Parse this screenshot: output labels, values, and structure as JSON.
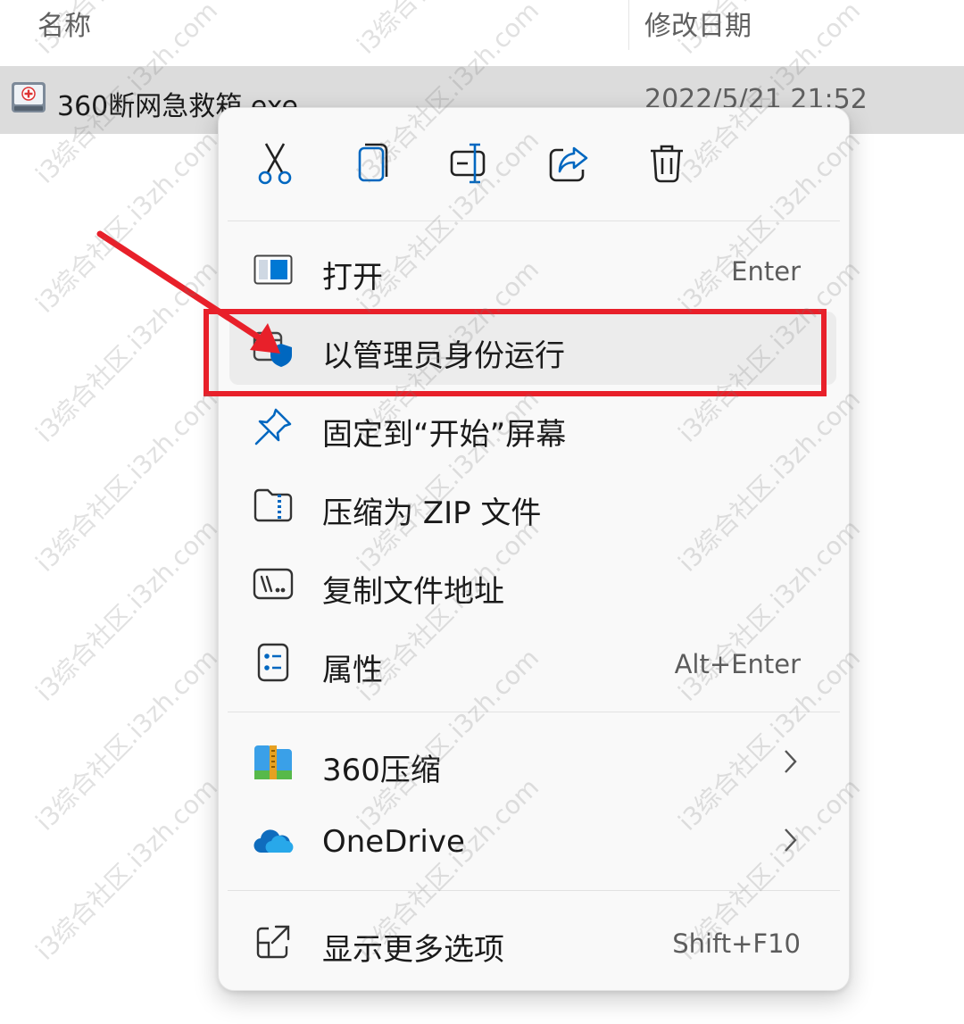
{
  "explorer": {
    "col_name": "名称",
    "col_date": "修改日期",
    "file": {
      "name": "360断网急救箱.exe",
      "date": "2022/5/21 21:52",
      "icon": "app-exe-icon"
    }
  },
  "menu": {
    "toolbar": [
      {
        "name": "cut",
        "icon": "scissors-icon"
      },
      {
        "name": "copy",
        "icon": "copy-icon"
      },
      {
        "name": "rename",
        "icon": "rename-icon"
      },
      {
        "name": "share",
        "icon": "share-icon"
      },
      {
        "name": "delete",
        "icon": "trash-icon"
      }
    ],
    "items": [
      {
        "label": "打开",
        "shortcut": "Enter",
        "icon": "open-window-icon"
      },
      {
        "label": "以管理员身份运行",
        "shortcut": "",
        "icon": "admin-shield-icon",
        "highlighted": true
      },
      {
        "label": "固定到“开始”屏幕",
        "shortcut": "",
        "icon": "pin-icon"
      },
      {
        "label": "压缩为 ZIP 文件",
        "shortcut": "",
        "icon": "zip-folder-icon"
      },
      {
        "label": "复制文件地址",
        "shortcut": "",
        "icon": "copy-path-icon"
      },
      {
        "label": "属性",
        "shortcut": "Alt+Enter",
        "icon": "properties-icon"
      }
    ],
    "submenus": [
      {
        "label": "360压缩",
        "icon": "360-zip-icon"
      },
      {
        "label": "OneDrive",
        "icon": "onedrive-cloud-icon"
      }
    ],
    "more": {
      "label": "显示更多选项",
      "shortcut": "Shift+F10",
      "icon": "more-options-icon"
    }
  },
  "watermark": "i3综合社区.i3zh.com",
  "colors": {
    "accent": "#0067c0",
    "annotation_red": "#e8202a",
    "menu_bg": "#f9f9f9"
  }
}
